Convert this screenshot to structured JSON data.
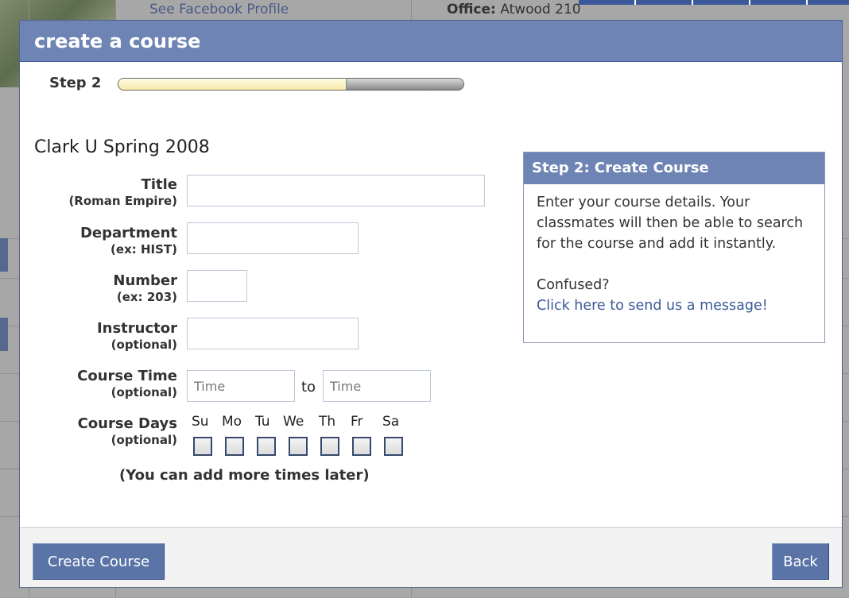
{
  "background": {
    "profile_link": "See Facebook Profile",
    "office_label": "Office:",
    "office_value": "Atwood 210"
  },
  "dialog": {
    "title": "create a course",
    "step_label": "Step 2",
    "progress": 0.66,
    "school_term": "Clark U Spring 2008",
    "fields": {
      "title": {
        "label": "Title",
        "hint": "(Roman Empire)",
        "value": ""
      },
      "department": {
        "label": "Department",
        "hint": "(ex: HIST)",
        "value": ""
      },
      "number": {
        "label": "Number",
        "hint": "(ex: 203)",
        "value": ""
      },
      "instructor": {
        "label": "Instructor",
        "hint": "(optional)",
        "value": ""
      },
      "course_time": {
        "label": "Course Time",
        "hint": "(optional)",
        "start_placeholder": "Time",
        "end_placeholder": "Time",
        "separator": "to"
      },
      "course_days": {
        "label": "Course Days",
        "hint": "(optional)",
        "days": [
          "Su",
          "Mo",
          "Tu",
          "We",
          "Th",
          "Fr",
          "Sa"
        ]
      }
    },
    "more_times_note": "(You can add more times later)",
    "help": {
      "heading": "Step 2: Create Course",
      "body": "Enter your course details. Your classmates will then be able to search for the course and add it instantly.",
      "confused": "Confused?",
      "link": "Click here to send us a message!"
    },
    "buttons": {
      "create": "Create Course",
      "back": "Back"
    }
  },
  "colors": {
    "header_blue": "#6d84b4",
    "button_blue": "#5b74a8",
    "link_blue": "#3b5998"
  }
}
